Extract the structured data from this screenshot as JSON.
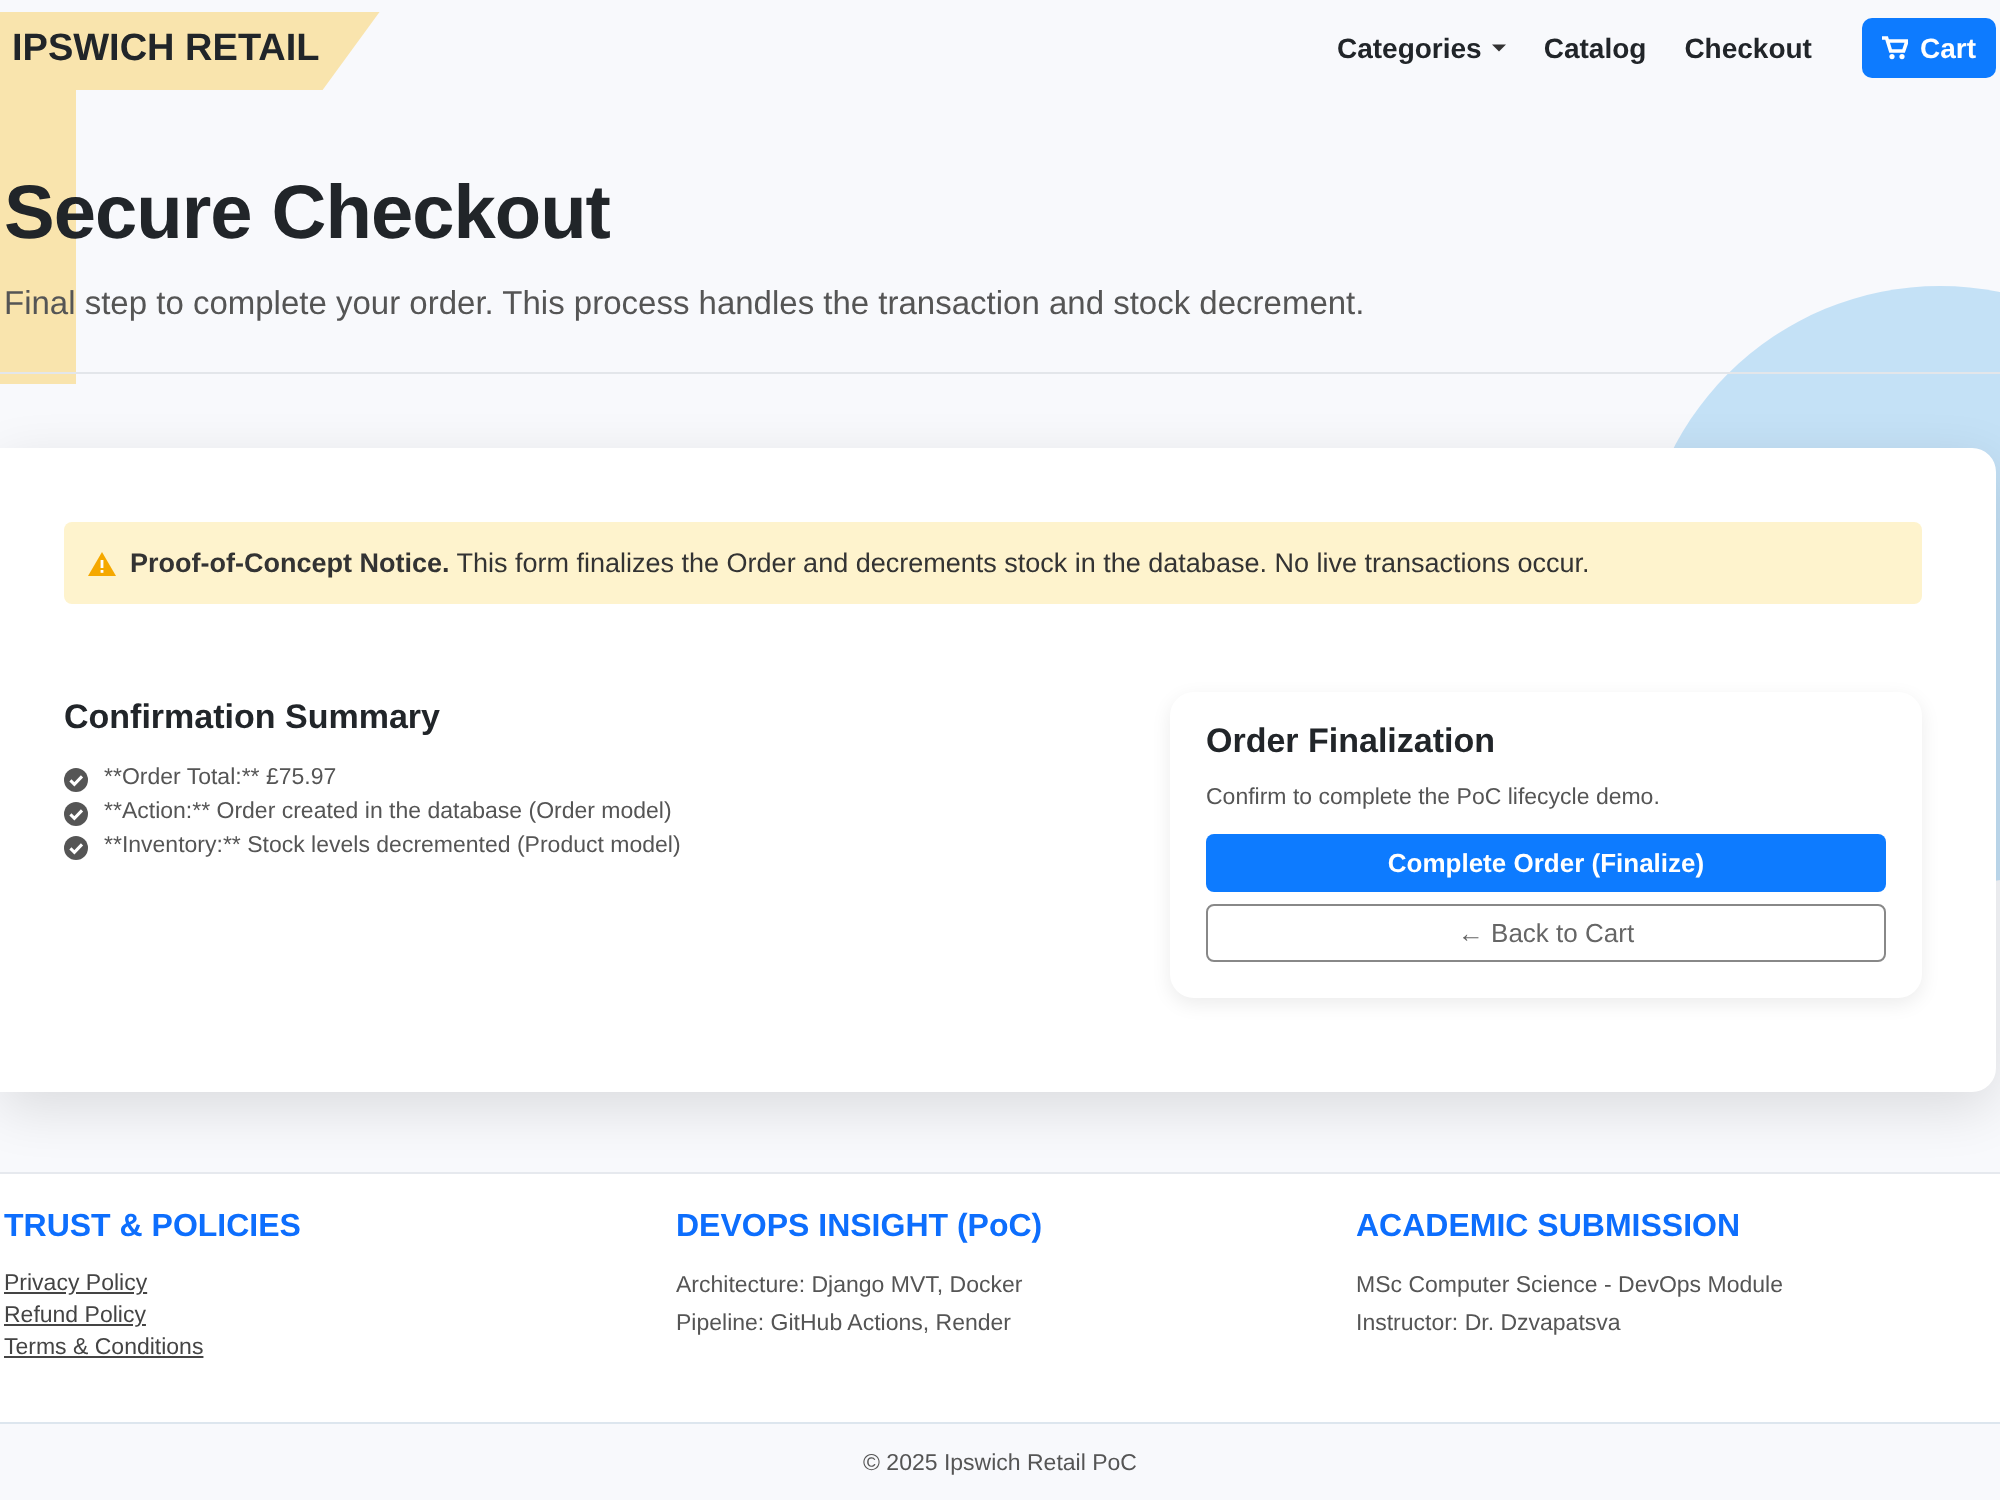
{
  "brand": "IPSWICH RETAIL",
  "nav": [
    {
      "label": "Categories",
      "kind": "dropdown"
    },
    {
      "label": "Catalog",
      "kind": "link"
    },
    {
      "label": "Checkout",
      "kind": "link"
    }
  ],
  "cart_button": "Cart",
  "hero": {
    "title": "Secure Checkout",
    "subtitle": "Final step to complete your order. This process handles the transaction and stock decrement."
  },
  "notice": {
    "text": "**Proof-of-Concept Notice.** This form finalizes the Order and decrements stock in the database. No live transactions occur."
  },
  "summary": {
    "title": "Confirmation Summary",
    "items": [
      "**Order Total:** £75.97",
      "**Action:** Order created in the database (Order model)",
      "**Inventory:** Stock levels decremented (Product model)"
    ]
  },
  "finalization": {
    "title": "Order Finalization",
    "text": "Confirm to complete the PoC lifecycle demo.",
    "primary_button": "Complete Order (Finalize)",
    "secondary_button": "← Back to Cart"
  },
  "footer": {
    "columns": [
      {
        "title": "TRUST & POLICIES",
        "kind": "links",
        "items": [
          "Privacy Policy",
          "Refund Policy",
          "Terms & Conditions"
        ]
      },
      {
        "title": "DEVOPS INSIGHT (PoC)",
        "kind": "text",
        "items": [
          "Architecture: Django MVT, Docker",
          "Pipeline: GitHub Actions, Render"
        ]
      },
      {
        "title": "ACADEMIC SUBMISSION",
        "kind": "text",
        "items": [
          "MSc Computer Science - DevOps Module",
          "Instructor: Dr. Dzvapatsva"
        ]
      }
    ],
    "copyright": "© 2025 Ipswich Retail PoC"
  }
}
